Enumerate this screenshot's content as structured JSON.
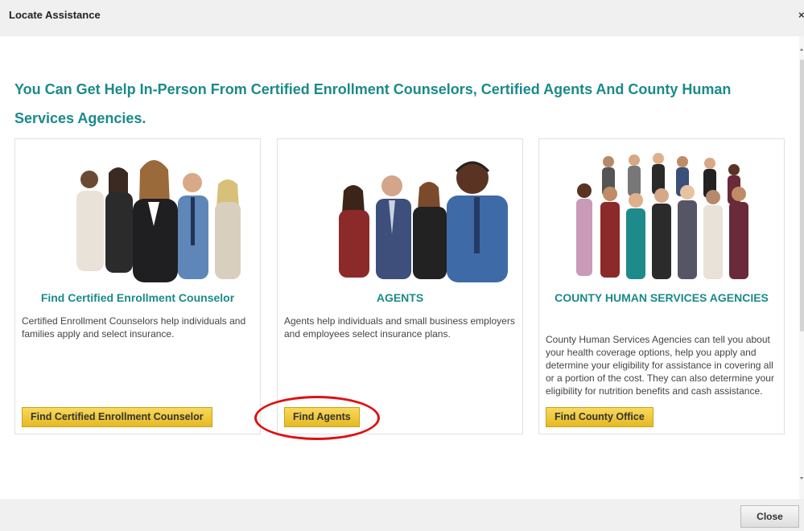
{
  "dialog": {
    "title": "Locate Assistance",
    "close_glyph": "×"
  },
  "headline": "You Can Get Help In-Person From Certified Enrollment Counselors, Certified Agents And County Human Services Agencies.",
  "cards": [
    {
      "title": "Find Certified Enrollment Counselor",
      "description": "Certified Enrollment Counselors help individuals and families apply and select insurance.",
      "button": "Find Certified Enrollment Counselor",
      "image": "group-of-professionals-photo"
    },
    {
      "title": "AGENTS",
      "description": "Agents help individuals and small business employers and employees select insurance plans.",
      "button": "Find Agents",
      "image": "call-center-agents-photo"
    },
    {
      "title": "COUNTY HUMAN SERVICES AGENCIES",
      "description": "County Human Services Agencies can tell you about your health coverage options, help you apply and determine your eligibility for assistance in covering all or a portion of the cost. They can also determine your eligibility for nutrition benefits and cash assistance.",
      "button": "Find County Office",
      "image": "diverse-crowd-photo"
    }
  ],
  "footer": {
    "close_label": "Close"
  },
  "colors": {
    "accent": "#1b8a8a",
    "button": "#f2cf47",
    "highlight": "#e01010"
  }
}
